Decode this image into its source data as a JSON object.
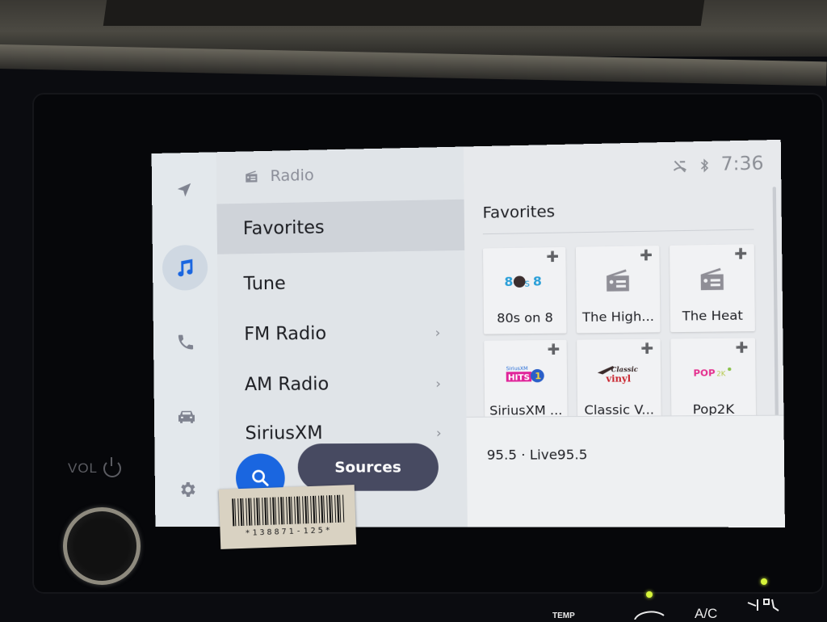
{
  "status_bar": {
    "time": "7:36",
    "icons": [
      "mic-muted-icon",
      "bluetooth-icon"
    ]
  },
  "rail": {
    "items": [
      {
        "name": "navigation",
        "icon": "navigation-arrow-icon",
        "active": false
      },
      {
        "name": "media",
        "icon": "music-note-icon",
        "active": true
      },
      {
        "name": "phone",
        "icon": "phone-icon",
        "active": false
      },
      {
        "name": "vehicle",
        "icon": "car-icon",
        "active": false
      },
      {
        "name": "settings",
        "icon": "gear-icon",
        "active": false
      }
    ]
  },
  "list_panel": {
    "header": {
      "icon": "radio-icon",
      "title": "Radio"
    },
    "items": [
      {
        "label": "Favorites",
        "selected": true,
        "has_chevron": false
      },
      {
        "label": "Tune",
        "selected": false,
        "has_chevron": false
      },
      {
        "label": "FM Radio",
        "selected": false,
        "has_chevron": true
      },
      {
        "label": "AM Radio",
        "selected": false,
        "has_chevron": true
      },
      {
        "label": "SiriusXM",
        "selected": false,
        "has_chevron": true
      }
    ],
    "search_button": {
      "icon": "search-icon"
    },
    "sources_button": {
      "label": "Sources"
    }
  },
  "content": {
    "title": "Favorites",
    "tiles": [
      {
        "name": "80s on 8",
        "logo": "80s on 8 logo",
        "logo_text": "8⁠s8"
      },
      {
        "name": "The High...",
        "logo": "radio-icon"
      },
      {
        "name": "The Heat",
        "logo": "radio-icon"
      },
      {
        "name": "SiriusXM ...",
        "logo": "SiriusXM Hits 1 logo",
        "logo_text": "HITS1"
      },
      {
        "name": "Classic V...",
        "logo": "Classic Vinyl logo",
        "logo_text": "vinyl"
      },
      {
        "name": "Pop2K",
        "logo": "Pop2K logo",
        "logo_text": "POP2K"
      }
    ],
    "now_playing": "95.5 · Live95.5"
  },
  "hardware": {
    "vol_label": "VOL",
    "barcode_number": "*138871-125*",
    "climate": {
      "temp_label": "TEMP",
      "ac_label": "A/C"
    }
  },
  "colors": {
    "accent": "#1a66e0",
    "sources_button": "#474a61",
    "led": "#d6f53a"
  }
}
